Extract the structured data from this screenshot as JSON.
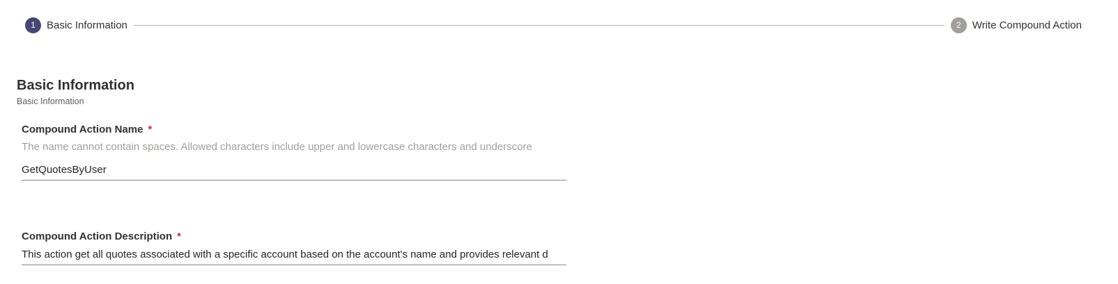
{
  "stepper": {
    "steps": [
      {
        "number": "1",
        "label": "Basic Information",
        "state": "active"
      },
      {
        "number": "2",
        "label": "Write Compound Action",
        "state": "inactive"
      }
    ]
  },
  "section": {
    "title": "Basic Information",
    "subtitle": "Basic Information"
  },
  "fields": {
    "name": {
      "label": "Compound Action Name",
      "required_mark": "*",
      "hint": "The name cannot contain spaces. Allowed characters include upper and lowercase characters and underscore",
      "value": "GetQuotesByUser"
    },
    "description": {
      "label": "Compound Action Description",
      "required_mark": "*",
      "value": "This action get all quotes associated with a specific account based on the account's name and provides relevant d"
    }
  },
  "colors": {
    "accent": "#464775",
    "inactive_step": "#a19f9d",
    "required": "#c4314b",
    "hint_text": "#a19f9d"
  }
}
